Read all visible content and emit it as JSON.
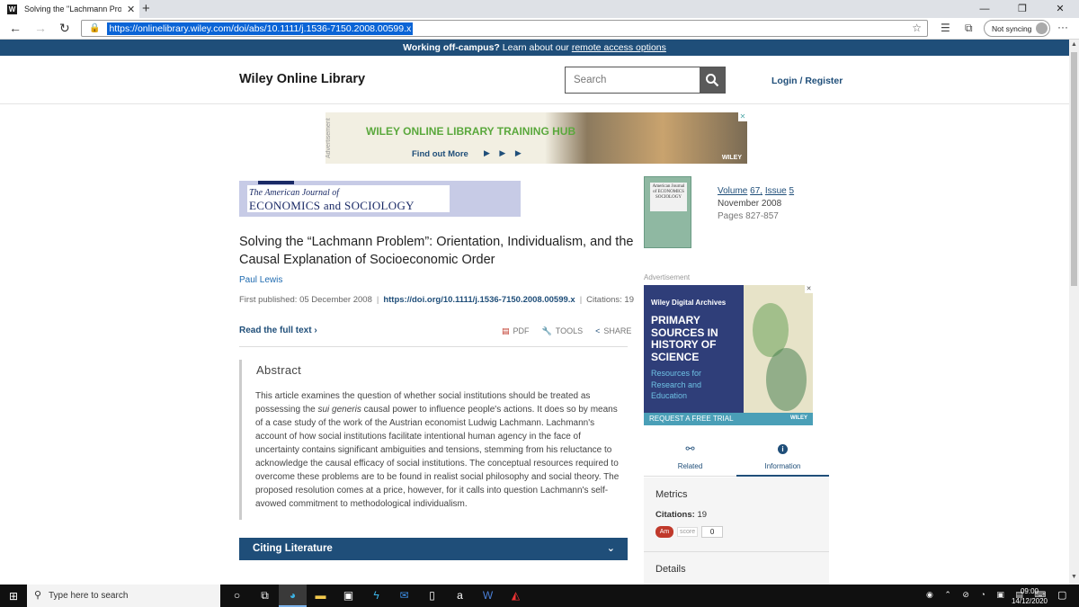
{
  "browser": {
    "tab_title": "Solving the \"Lachmann Problem",
    "favicon_letter": "W",
    "url": "https://onlinelibrary.wiley.com/doi/abs/10.1111/j.1536-7150.2008.00599.x",
    "sync_label": "Not syncing"
  },
  "banner": {
    "bold": "Working off-campus?",
    "text": " Learn about our ",
    "link": "remote access options"
  },
  "site": {
    "logo": "Wiley Online Library",
    "search_placeholder": "Search",
    "login": "Login / Register"
  },
  "ad_top": {
    "side_label": "Advertisement",
    "headline": "WILEY ONLINE LIBRARY TRAINING HUB",
    "cta": "Find out More",
    "arrows": "▶ ▶ ▶",
    "brand": "WILEY"
  },
  "journal": {
    "line1": "The American Journal of",
    "line2": "ECONOMICS and SOCIOLOGY",
    "cover_text": "American Journal of ECONOMICS SOCIOLOGY"
  },
  "issue": {
    "volume": "Volume",
    "volume_num": "67",
    "issue": "Issue",
    "issue_num": "5",
    "date": "November 2008",
    "pages": "Pages 827-857"
  },
  "article": {
    "title": "Solving the “Lachmann Problem”: Orientation, Individualism, and the Causal Explanation of Socioeconomic Order",
    "author": "Paul Lewis",
    "first_published_label": "First published:",
    "first_published": "05 December 2008",
    "doi": "https://doi.org/10.1111/j.1536-7150.2008.00599.x",
    "citations": "Citations: 19",
    "read_full": "Read the full text",
    "tools": [
      "PDF",
      "TOOLS",
      "SHARE"
    ]
  },
  "abstract": {
    "heading": "Abstract",
    "text_before": "This article examines the question of whether social institutions should be treated as possessing the ",
    "italic": "sui generis",
    "text_after": " causal power to influence people's actions. It does so by means of a case study of the work of the Austrian economist Ludwig Lachmann. Lachmann's account of how social institutions facilitate intentional human agency in the face of uncertainty contains significant ambiguities and tensions, stemming from his reluctance to acknowledge the causal efficacy of social institutions. The conceptual resources required to overcome these problems are to be found in realist social philosophy and social theory. The proposed resolution comes at a price, however, for it calls into question Lachmann's self-avowed commitment to methodological individualism."
  },
  "citing": {
    "label": "Citing Literature"
  },
  "ad_side": {
    "label": "Advertisement",
    "brand": "Wiley Digital Archives",
    "headline": "PRIMARY SOURCES IN HISTORY OF SCIENCE",
    "sub": "Resources for Research and Education",
    "cta": "REQUEST A FREE TRIAL",
    "logo": "WILEY"
  },
  "right_tabs": {
    "related": "Related",
    "information": "Information"
  },
  "metrics": {
    "heading": "Metrics",
    "citations_label": "Citations:",
    "citations_value": "19",
    "altmetric_badge": "Am",
    "altmetric_label": "score",
    "altmetric_value": "0",
    "details": "Details"
  },
  "taskbar": {
    "search_placeholder": "Type here to search",
    "time": "09:00",
    "date": "14/12/2020"
  }
}
